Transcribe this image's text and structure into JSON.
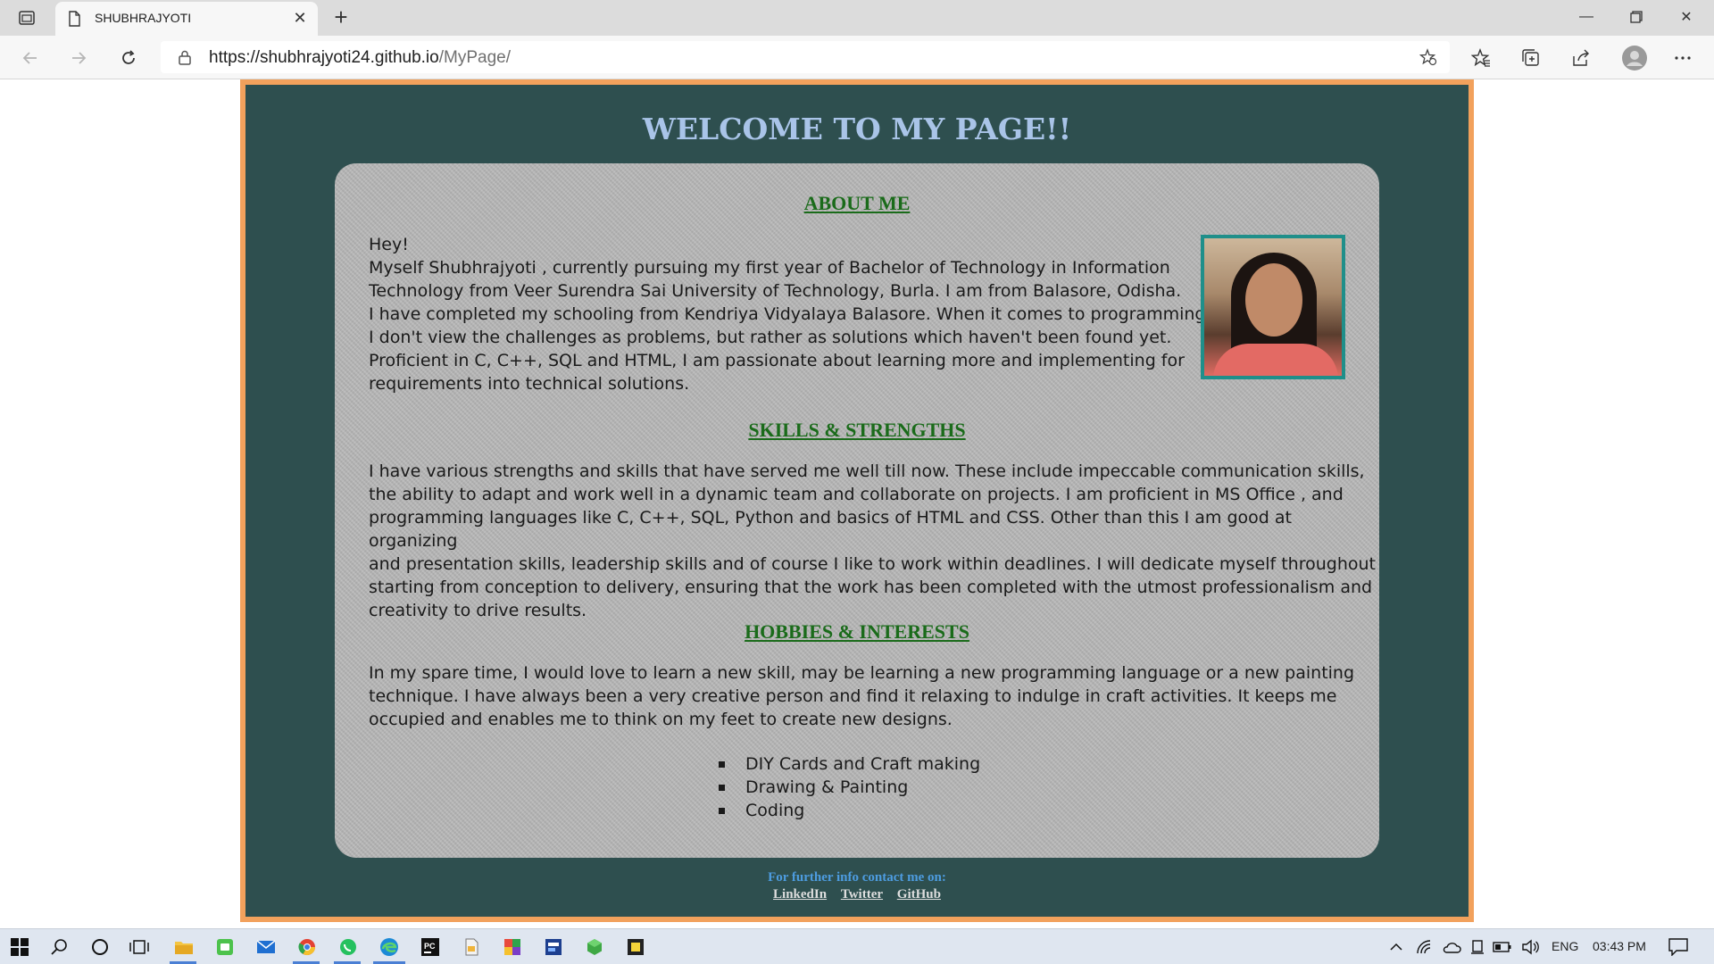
{
  "browser": {
    "tab_title": "SHUBHRAJYOTI",
    "url_host": "https://shubhrajyoti24.github.io",
    "url_path": "/MyPage/"
  },
  "page": {
    "title": "WELCOME TO MY PAGE!!",
    "about": {
      "heading": "ABOUT ME",
      "lines": [
        "Hey!",
        "Myself Shubhrajyoti , currently pursuing my first year of Bachelor of Technology in Information",
        "Technology from Veer Surendra Sai University of Technology,  Burla. I am from Balasore, Odisha.",
        "I have completed my schooling from Kendriya Vidyalaya Balasore. When it comes to programming,",
        "I don't view the challenges as problems, but rather as solutions which haven't been found yet.",
        "Proficient in C, C++, SQL and HTML, I am passionate about learning more and implementing for",
        "requirements into technical solutions."
      ]
    },
    "skills": {
      "heading": "SKILLS & STRENGTHS",
      "lines": [
        "I have various strengths and skills that have served me well till now.  These include impeccable communication skills,",
        "the ability to adapt and work well in a dynamic team and collaborate on projects.  I am proficient in MS Office , and",
        "programming languages like C, C++, SQL, Python and basics of HTML and CSS. Other than this I am good at organizing",
        "and presentation skills, leadership skills and of course I like to work within deadlines. I will dedicate myself throughout",
        "starting from conception to delivery, ensuring that the work has been completed with the utmost professionalism and",
        "creativity to drive results."
      ]
    },
    "hobbies": {
      "heading": "HOBBIES & INTERESTS",
      "lines": [
        "In my spare time, I would love to learn a new skill, may be learning a new programming language or a new painting",
        "technique. I have always been a very creative person and find it relaxing to indulge in craft activities. It keeps me",
        "occupied and enables me to think on my feet to create new designs."
      ],
      "items": [
        "DIY Cards and Craft making",
        "Drawing & Painting",
        "Coding"
      ]
    },
    "footer": {
      "text": "For further info contact me on:",
      "links": [
        "LinkedIn",
        "Twitter",
        "GitHub"
      ]
    }
  },
  "taskbar": {
    "language": "ENG",
    "time": "03:43 PM"
  },
  "colors": {
    "page_bg": "#2e4f4f",
    "frame_border": "#f2a15c",
    "title": "#a9c4e8",
    "heading": "#1a6b1a",
    "footer_text": "#4d9ce0"
  }
}
